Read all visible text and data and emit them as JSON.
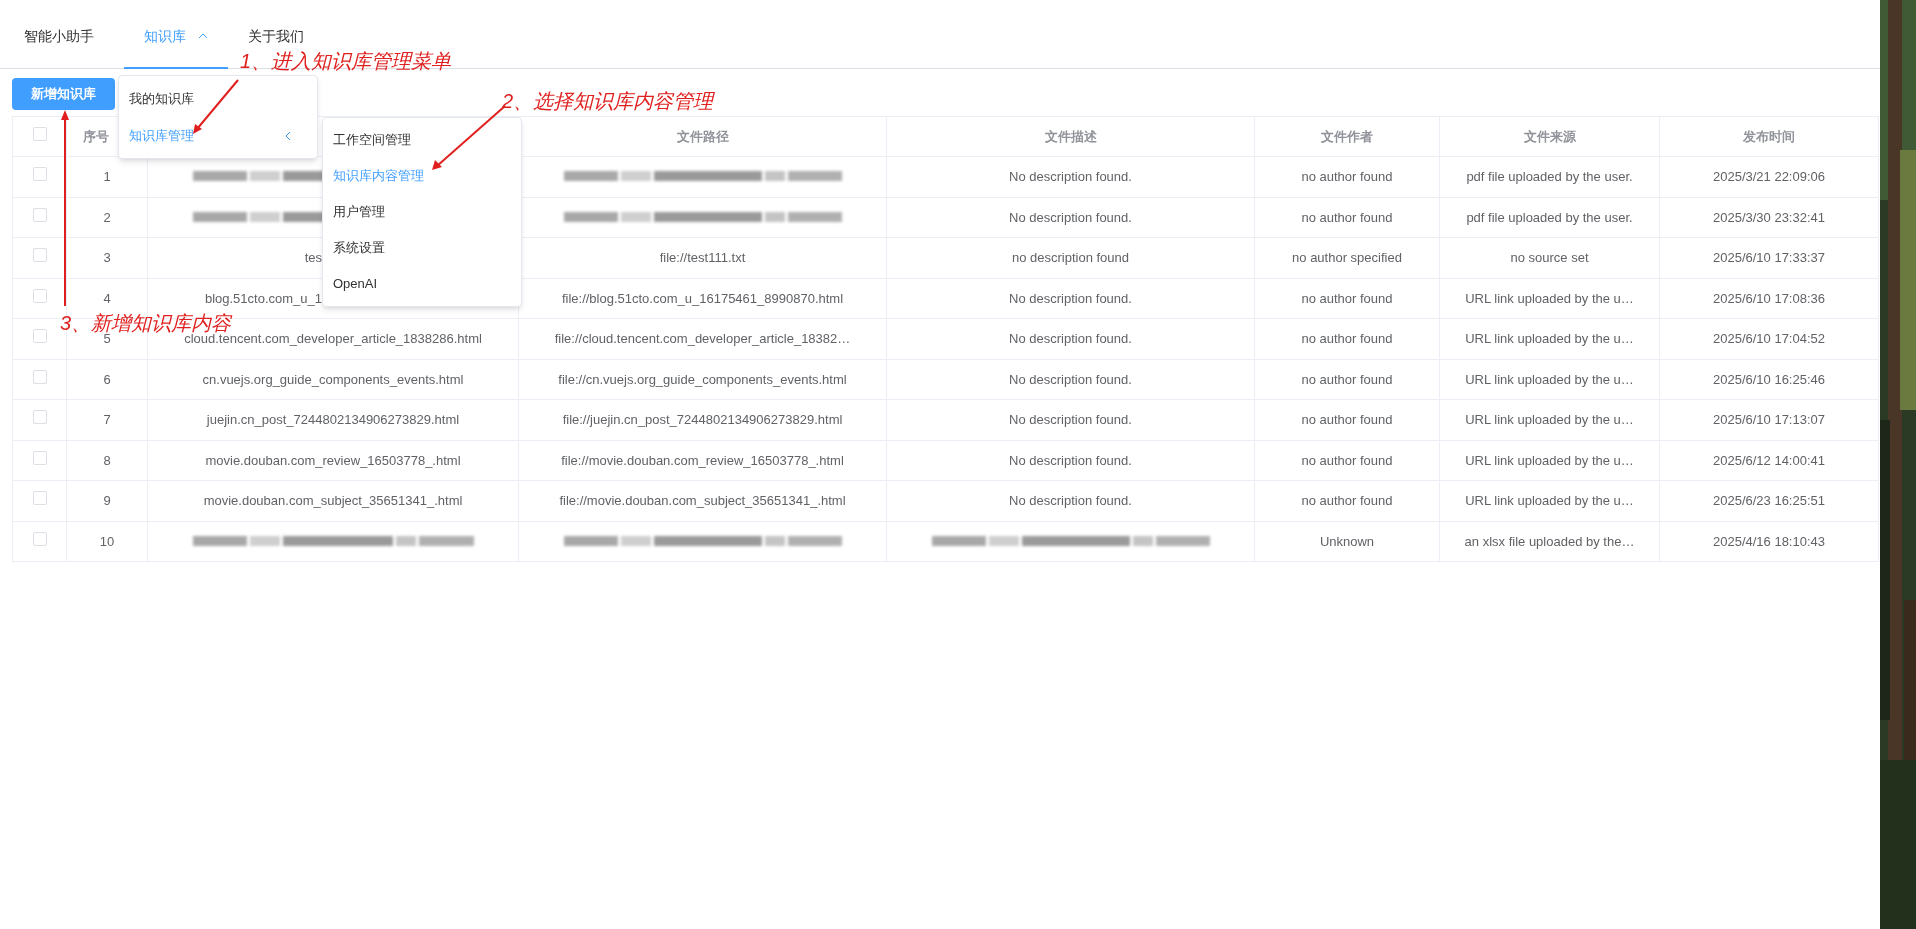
{
  "nav": [
    {
      "label": "智能小助手",
      "selected": false,
      "expanded": false
    },
    {
      "label": "知识库",
      "selected": true,
      "expanded": true
    },
    {
      "label": "关于我们",
      "selected": false,
      "expanded": false
    }
  ],
  "add_button": "新增知识库",
  "menu": [
    {
      "label": "我的知识库",
      "selected": false,
      "has_submenu": false
    },
    {
      "label": "知识库管理",
      "selected": true,
      "has_submenu": true
    }
  ],
  "submenu": [
    {
      "label": "工作空间管理",
      "selected": false
    },
    {
      "label": "知识库内容管理",
      "selected": true
    },
    {
      "label": "用户管理",
      "selected": false
    },
    {
      "label": "系统设置",
      "selected": false
    },
    {
      "label": "OpenAI",
      "selected": false
    }
  ],
  "annotations": [
    "1、进入知识库管理菜单",
    "2、选择知识库内容管理",
    "3、新增知识库内容"
  ],
  "table": {
    "header_checked": false,
    "columns": {
      "index": "序号",
      "path": "文件路径",
      "description": "文件描述",
      "author": "文件作者",
      "source": "文件来源",
      "time": "发布时间"
    },
    "rows": [
      {
        "checked": false,
        "index": "1",
        "name": {
          "kind": "blurred"
        },
        "path": {
          "kind": "blurred"
        },
        "description": "No description found.",
        "author": "no author found",
        "source": "pdf file uploaded by the user.",
        "time": "2025/3/21 22:09:06"
      },
      {
        "checked": false,
        "index": "2",
        "name": {
          "kind": "blurred"
        },
        "path": {
          "kind": "blurred"
        },
        "description": "No description found.",
        "author": "no author found",
        "source": "pdf file uploaded by the user.",
        "time": "2025/3/30 23:32:41"
      },
      {
        "checked": false,
        "index": "3",
        "name": {
          "kind": "cut",
          "text": "tes"
        },
        "path": "file://test111.txt",
        "description": "no description found",
        "author": "no author specified",
        "source": "no source set",
        "time": "2025/6/10 17:33:37"
      },
      {
        "checked": false,
        "index": "4",
        "name": {
          "kind": "cut",
          "text": "blog.51cto.com_u_1"
        },
        "path": "file://blog.51cto.com_u_16175461_8990870.html",
        "description": "No description found.",
        "author": "no author found",
        "source": "URL link uploaded by the u…",
        "time": "2025/6/10 17:08:36"
      },
      {
        "checked": false,
        "index": "5",
        "name": "cloud.tencent.com_developer_article_1838286.html",
        "path": "file://cloud.tencent.com_developer_article_18382…",
        "description": "No description found.",
        "author": "no author found",
        "source": "URL link uploaded by the u…",
        "time": "2025/6/10 17:04:52"
      },
      {
        "checked": false,
        "index": "6",
        "name": "cn.vuejs.org_guide_components_events.html",
        "path": "file://cn.vuejs.org_guide_components_events.html",
        "description": "No description found.",
        "author": "no author found",
        "source": "URL link uploaded by the u…",
        "time": "2025/6/10 16:25:46"
      },
      {
        "checked": false,
        "index": "7",
        "name": "juejin.cn_post_7244802134906273829.html",
        "path": "file://juejin.cn_post_7244802134906273829.html",
        "description": "No description found.",
        "author": "no author found",
        "source": "URL link uploaded by the u…",
        "time": "2025/6/10 17:13:07"
      },
      {
        "checked": false,
        "index": "8",
        "name": "movie.douban.com_review_16503778_.html",
        "path": "file://movie.douban.com_review_16503778_.html",
        "description": "No description found.",
        "author": "no author found",
        "source": "URL link uploaded by the u…",
        "time": "2025/6/12 14:00:41"
      },
      {
        "checked": false,
        "index": "9",
        "name": "movie.douban.com_subject_35651341_.html",
        "path": "file://movie.douban.com_subject_35651341_.html",
        "description": "No description found.",
        "author": "no author found",
        "source": "URL link uploaded by the u…",
        "time": "2025/6/23 16:25:51"
      },
      {
        "checked": false,
        "index": "10",
        "name": {
          "kind": "blurred"
        },
        "path": {
          "kind": "blurred"
        },
        "description": {
          "kind": "blurred"
        },
        "author": "Unknown",
        "source": "an xlsx file uploaded by the…",
        "time": "2025/4/16 18:10:43"
      }
    ]
  }
}
